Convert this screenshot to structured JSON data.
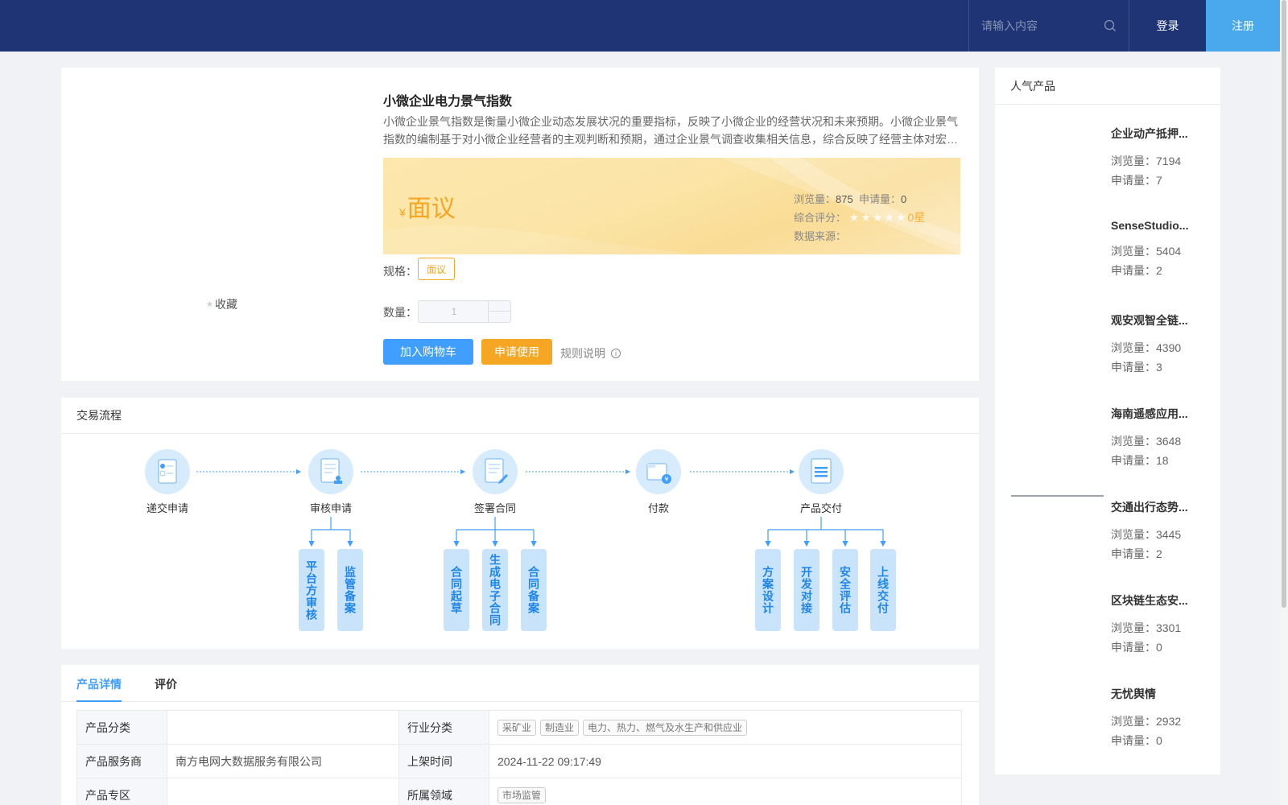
{
  "header": {
    "search_placeholder": "请输入内容",
    "login": "登录",
    "register": "注册"
  },
  "product": {
    "favorite": "收藏",
    "title": "小微企业电力景气指数",
    "description": "小微企业景气指数是衡量小微企业动态发展状况的重要指标，反映了小微企业的经营状况和未来预期。小微企业景气指数的编制基于对小微企业经营者的主观判断和预期，通过企业景气调查收集相关信息，综合反映了经营主体对宏观经济环境的感受和信心。",
    "currency": "¥",
    "price": "面议",
    "views_label": "浏览量：",
    "views": "875",
    "apply_label": "申请量：",
    "apply": "0",
    "rating_label": "综合评分：",
    "rating": "0星",
    "source_label": "数据来源：",
    "spec_label": "规格：",
    "spec_value": "面议",
    "qty_label": "数量：",
    "qty_value": "1",
    "add_cart": "加入购物车",
    "apply_use": "申请使用",
    "rules": "规则说明"
  },
  "flow": {
    "title": "交易流程",
    "steps": [
      "递交申请",
      "审核申请",
      "签署合同",
      "付款",
      "产品交付"
    ],
    "subs": {
      "review": [
        "平台方审核",
        "监管备案"
      ],
      "contract": [
        "合同起草",
        "生成电子合同",
        "合同备案"
      ],
      "delivery": [
        "方案设计",
        "开发对接",
        "安全评估",
        "上线交付"
      ]
    }
  },
  "detail": {
    "tabs": [
      "产品详情",
      "评价"
    ],
    "rows": [
      {
        "k1": "产品分类",
        "v1": "",
        "k2": "行业分类",
        "tags": [
          "采矿业",
          "制造业",
          "电力、热力、燃气及水生产和供应业"
        ]
      },
      {
        "k1": "产品服务商",
        "v1": "南方电网大数据服务有限公司",
        "k2": "上架时间",
        "v2": "2024-11-22 09:17:49"
      },
      {
        "k1": "产品专区",
        "v1": "",
        "k2": "所属领域",
        "tags": [
          "市场监管"
        ]
      }
    ]
  },
  "sidebar": {
    "title": "人气产品",
    "views_label": "浏览量：",
    "apply_label": "申请量：",
    "items": [
      {
        "name": "企业动产抵押...",
        "views": "7194",
        "apply": "7"
      },
      {
        "name": "SenseStudio...",
        "views": "5404",
        "apply": "2"
      },
      {
        "name": "观安观智全链...",
        "views": "4390",
        "apply": "3"
      },
      {
        "name": "海南遥感应用...",
        "views": "3648",
        "apply": "18"
      },
      {
        "name": "交通出行态势...",
        "views": "3445",
        "apply": "2"
      },
      {
        "name": "区块链生态安...",
        "views": "3301",
        "apply": "0"
      },
      {
        "name": "无忧舆情",
        "views": "2932",
        "apply": "0"
      }
    ]
  },
  "colors": {
    "header": "#1f3475",
    "primary": "#409eff",
    "accent": "#f5a623",
    "register": "#4aa8ec"
  }
}
